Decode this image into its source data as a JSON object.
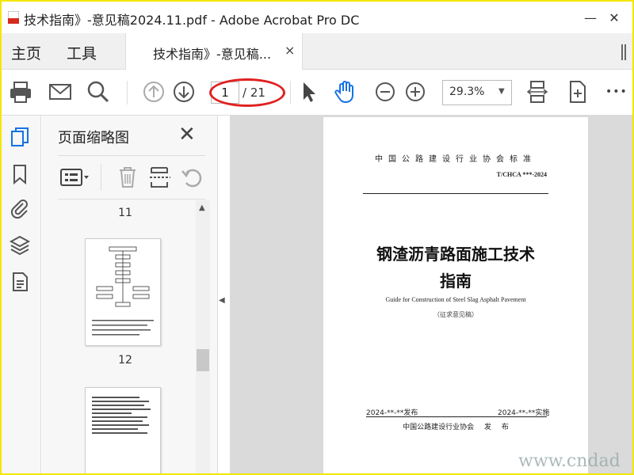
{
  "window": {
    "title": "技术指南》-意见稿2024.11.pdf - Adobe Acrobat Pro DC",
    "minimize_glyph": "—",
    "restore_glyph": "☐",
    "close_glyph": "✕"
  },
  "tabs": {
    "home": "主页",
    "tools": "工具",
    "document": "技术指南》-意见稿...",
    "close_glyph": "×"
  },
  "toolbar": {
    "page_current": "1",
    "page_total": "/ 21",
    "zoom": "29.3%",
    "more_glyph": "•••"
  },
  "panel": {
    "title": "页面缩略图",
    "close_glyph": "✕",
    "thumbnails": [
      {
        "label": "11"
      },
      {
        "label": "12"
      }
    ]
  },
  "document_page": {
    "header": "中国公路建设行业协会标准",
    "code": "T/CHCA ***-2024",
    "title_line1": "钢渣沥青路面施工技术",
    "title_line2": "指南",
    "subtitle": "Guide for Construction of Steel Slag Asphalt Pavement",
    "note": "（征求意见稿）",
    "issue_date": "2024-**-**发布",
    "impl_date": "2024-**-**实施",
    "issuer": "中国公路建设行业协会 发 布"
  },
  "watermark": "www.cndad",
  "colors": {
    "frame": "#f5e600",
    "accent_blue": "#1473e6",
    "annotation_red": "#e02020"
  }
}
